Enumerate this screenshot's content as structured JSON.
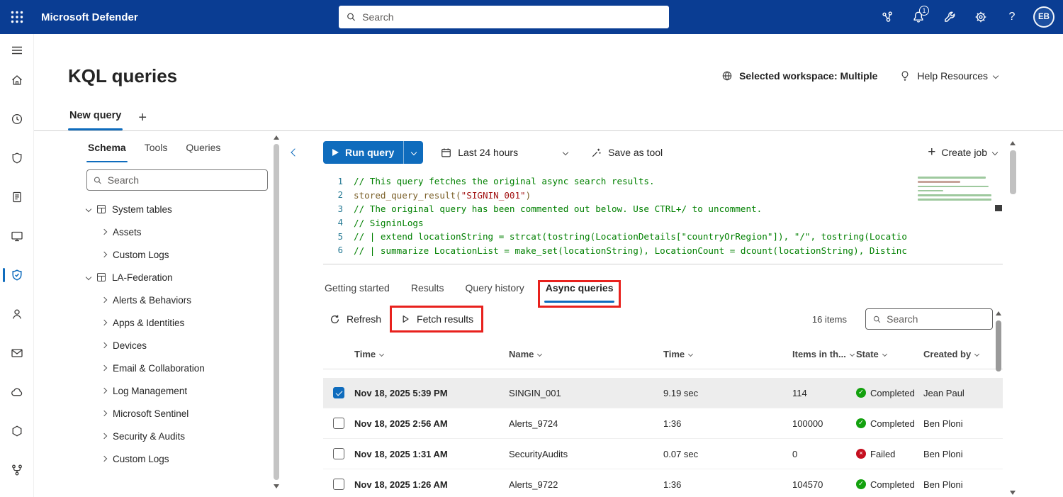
{
  "topbar": {
    "app_title": "Microsoft Defender",
    "search_placeholder": "Search",
    "notification_badge": "1",
    "avatar_initials": "EB"
  },
  "page_header": {
    "title": "KQL queries",
    "workspace_label": "Selected workspace: Multiple",
    "help_label": "Help Resources"
  },
  "query_tabs": {
    "tabs": [
      {
        "label": "New query",
        "active": true
      }
    ]
  },
  "schema_panel": {
    "tabs": [
      {
        "label": "Schema",
        "active": true
      },
      {
        "label": "Tools",
        "active": false
      },
      {
        "label": "Queries",
        "active": false
      }
    ],
    "search_placeholder": "Search",
    "tree": [
      {
        "label": "System tables",
        "level": 0,
        "expanded": true,
        "has_icon": true
      },
      {
        "label": "Assets",
        "level": 1,
        "expanded": false,
        "has_icon": false
      },
      {
        "label": "Custom Logs",
        "level": 1,
        "expanded": false,
        "has_icon": false
      },
      {
        "label": "LA-Federation",
        "level": 0,
        "expanded": true,
        "has_icon": true
      },
      {
        "label": "Alerts & Behaviors",
        "level": 1,
        "expanded": false,
        "has_icon": false
      },
      {
        "label": "Apps & Identities",
        "level": 1,
        "expanded": false,
        "has_icon": false
      },
      {
        "label": "Devices",
        "level": 1,
        "expanded": false,
        "has_icon": false
      },
      {
        "label": "Email & Collaboration",
        "level": 1,
        "expanded": false,
        "has_icon": false
      },
      {
        "label": "Log Management",
        "level": 1,
        "expanded": false,
        "has_icon": false
      },
      {
        "label": "Microsoft Sentinel",
        "level": 1,
        "expanded": false,
        "has_icon": false
      },
      {
        "label": "Security & Audits",
        "level": 1,
        "expanded": false,
        "has_icon": false
      },
      {
        "label": "Custom Logs",
        "level": 1,
        "expanded": false,
        "has_icon": false
      }
    ]
  },
  "editor": {
    "run_button": "Run query",
    "time_range": "Last 24 hours",
    "save_as_tool": "Save as tool",
    "create_job": "Create job",
    "code_lines": [
      {
        "n": "1",
        "segments": [
          {
            "text": "// This query fetches the original async search results.",
            "type": "comment"
          }
        ]
      },
      {
        "n": "2",
        "segments": [
          {
            "text": "stored_query_result(",
            "type": "function"
          },
          {
            "text": "\"SIGNIN_001\"",
            "type": "string"
          },
          {
            "text": ")",
            "type": "function"
          }
        ]
      },
      {
        "n": "3",
        "segments": [
          {
            "text": "// The original query has been commented out below. Use CTRL+/ to uncomment.",
            "type": "comment"
          }
        ]
      },
      {
        "n": "4",
        "segments": [
          {
            "text": "// SigninLogs",
            "type": "comment"
          }
        ]
      },
      {
        "n": "5",
        "segments": [
          {
            "text": "// | extend locationString = strcat(tostring(LocationDetails[\"countryOrRegion\"]), \"/\", tostring(Locatio",
            "type": "comment"
          }
        ]
      },
      {
        "n": "6",
        "segments": [
          {
            "text": "// | summarize LocationList = make_set(locationString), LocationCount = dcount(locationString), Distinc",
            "type": "comment"
          }
        ]
      }
    ]
  },
  "results_panel": {
    "tabs": [
      {
        "label": "Getting started",
        "active": false
      },
      {
        "label": "Results",
        "active": false
      },
      {
        "label": "Query history",
        "active": false
      },
      {
        "label": "Async queries",
        "active": true
      }
    ],
    "refresh_label": "Refresh",
    "fetch_results_label": "Fetch results",
    "items_count": "16 items",
    "search_placeholder": "Search",
    "columns": [
      "Time",
      "Name",
      "Time",
      "Items in th...",
      "State",
      "Created by"
    ],
    "rows": [
      {
        "checked": true,
        "selected": true,
        "time": "Nov 18, 2025 5:39 PM",
        "name": "SINGIN_001",
        "duration": "9.19 sec",
        "items": "114",
        "state": "Completed",
        "state_type": "completed",
        "created_by": "Jean Paul"
      },
      {
        "checked": false,
        "selected": false,
        "time": "Nov 18, 2025 2:56 AM",
        "name": "Alerts_9724",
        "duration": "1:36",
        "items": "100000",
        "state": "Completed",
        "state_type": "completed",
        "created_by": "Ben Ploni"
      },
      {
        "checked": false,
        "selected": false,
        "time": "Nov 18, 2025 1:31 AM",
        "name": "SecurityAudits",
        "duration": "0.07 sec",
        "items": "0",
        "state": "Failed",
        "state_type": "failed",
        "created_by": "Ben Ploni"
      },
      {
        "checked": false,
        "selected": false,
        "time": "Nov 18, 2025 1:26 AM",
        "name": "Alerts_9722",
        "duration": "1:36",
        "items": "104570",
        "state": "Completed",
        "state_type": "completed",
        "created_by": "Ben Ploni"
      }
    ]
  },
  "icons": {
    "add_tab": "+",
    "help": "?",
    "checkmark": "✓",
    "cross": "×"
  },
  "colors": {
    "topbar_blue": "#0a3d93",
    "accent_blue": "#0f6cbd",
    "success_green": "#13a10e",
    "error_red": "#c50f1f",
    "annotation_red": "#e8211d"
  }
}
